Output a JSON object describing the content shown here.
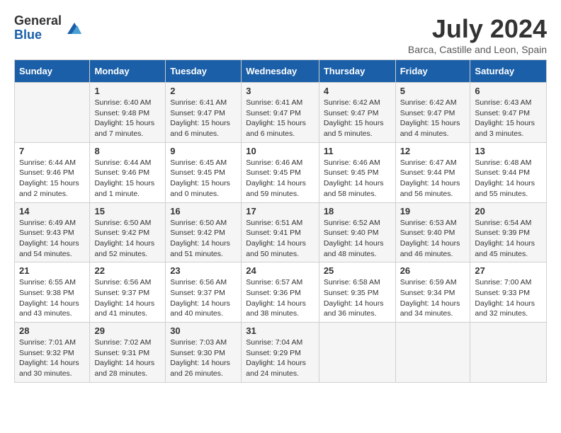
{
  "header": {
    "logo_general": "General",
    "logo_blue": "Blue",
    "month_title": "July 2024",
    "location": "Barca, Castille and Leon, Spain"
  },
  "days_of_week": [
    "Sunday",
    "Monday",
    "Tuesday",
    "Wednesday",
    "Thursday",
    "Friday",
    "Saturday"
  ],
  "weeks": [
    [
      {
        "day": "",
        "text": ""
      },
      {
        "day": "1",
        "text": "Sunrise: 6:40 AM\nSunset: 9:48 PM\nDaylight: 15 hours\nand 7 minutes."
      },
      {
        "day": "2",
        "text": "Sunrise: 6:41 AM\nSunset: 9:47 PM\nDaylight: 15 hours\nand 6 minutes."
      },
      {
        "day": "3",
        "text": "Sunrise: 6:41 AM\nSunset: 9:47 PM\nDaylight: 15 hours\nand 6 minutes."
      },
      {
        "day": "4",
        "text": "Sunrise: 6:42 AM\nSunset: 9:47 PM\nDaylight: 15 hours\nand 5 minutes."
      },
      {
        "day": "5",
        "text": "Sunrise: 6:42 AM\nSunset: 9:47 PM\nDaylight: 15 hours\nand 4 minutes."
      },
      {
        "day": "6",
        "text": "Sunrise: 6:43 AM\nSunset: 9:47 PM\nDaylight: 15 hours\nand 3 minutes."
      }
    ],
    [
      {
        "day": "7",
        "text": "Sunrise: 6:44 AM\nSunset: 9:46 PM\nDaylight: 15 hours\nand 2 minutes."
      },
      {
        "day": "8",
        "text": "Sunrise: 6:44 AM\nSunset: 9:46 PM\nDaylight: 15 hours\nand 1 minute."
      },
      {
        "day": "9",
        "text": "Sunrise: 6:45 AM\nSunset: 9:45 PM\nDaylight: 15 hours\nand 0 minutes."
      },
      {
        "day": "10",
        "text": "Sunrise: 6:46 AM\nSunset: 9:45 PM\nDaylight: 14 hours\nand 59 minutes."
      },
      {
        "day": "11",
        "text": "Sunrise: 6:46 AM\nSunset: 9:45 PM\nDaylight: 14 hours\nand 58 minutes."
      },
      {
        "day": "12",
        "text": "Sunrise: 6:47 AM\nSunset: 9:44 PM\nDaylight: 14 hours\nand 56 minutes."
      },
      {
        "day": "13",
        "text": "Sunrise: 6:48 AM\nSunset: 9:44 PM\nDaylight: 14 hours\nand 55 minutes."
      }
    ],
    [
      {
        "day": "14",
        "text": "Sunrise: 6:49 AM\nSunset: 9:43 PM\nDaylight: 14 hours\nand 54 minutes."
      },
      {
        "day": "15",
        "text": "Sunrise: 6:50 AM\nSunset: 9:42 PM\nDaylight: 14 hours\nand 52 minutes."
      },
      {
        "day": "16",
        "text": "Sunrise: 6:50 AM\nSunset: 9:42 PM\nDaylight: 14 hours\nand 51 minutes."
      },
      {
        "day": "17",
        "text": "Sunrise: 6:51 AM\nSunset: 9:41 PM\nDaylight: 14 hours\nand 50 minutes."
      },
      {
        "day": "18",
        "text": "Sunrise: 6:52 AM\nSunset: 9:40 PM\nDaylight: 14 hours\nand 48 minutes."
      },
      {
        "day": "19",
        "text": "Sunrise: 6:53 AM\nSunset: 9:40 PM\nDaylight: 14 hours\nand 46 minutes."
      },
      {
        "day": "20",
        "text": "Sunrise: 6:54 AM\nSunset: 9:39 PM\nDaylight: 14 hours\nand 45 minutes."
      }
    ],
    [
      {
        "day": "21",
        "text": "Sunrise: 6:55 AM\nSunset: 9:38 PM\nDaylight: 14 hours\nand 43 minutes."
      },
      {
        "day": "22",
        "text": "Sunrise: 6:56 AM\nSunset: 9:37 PM\nDaylight: 14 hours\nand 41 minutes."
      },
      {
        "day": "23",
        "text": "Sunrise: 6:56 AM\nSunset: 9:37 PM\nDaylight: 14 hours\nand 40 minutes."
      },
      {
        "day": "24",
        "text": "Sunrise: 6:57 AM\nSunset: 9:36 PM\nDaylight: 14 hours\nand 38 minutes."
      },
      {
        "day": "25",
        "text": "Sunrise: 6:58 AM\nSunset: 9:35 PM\nDaylight: 14 hours\nand 36 minutes."
      },
      {
        "day": "26",
        "text": "Sunrise: 6:59 AM\nSunset: 9:34 PM\nDaylight: 14 hours\nand 34 minutes."
      },
      {
        "day": "27",
        "text": "Sunrise: 7:00 AM\nSunset: 9:33 PM\nDaylight: 14 hours\nand 32 minutes."
      }
    ],
    [
      {
        "day": "28",
        "text": "Sunrise: 7:01 AM\nSunset: 9:32 PM\nDaylight: 14 hours\nand 30 minutes."
      },
      {
        "day": "29",
        "text": "Sunrise: 7:02 AM\nSunset: 9:31 PM\nDaylight: 14 hours\nand 28 minutes."
      },
      {
        "day": "30",
        "text": "Sunrise: 7:03 AM\nSunset: 9:30 PM\nDaylight: 14 hours\nand 26 minutes."
      },
      {
        "day": "31",
        "text": "Sunrise: 7:04 AM\nSunset: 9:29 PM\nDaylight: 14 hours\nand 24 minutes."
      },
      {
        "day": "",
        "text": ""
      },
      {
        "day": "",
        "text": ""
      },
      {
        "day": "",
        "text": ""
      }
    ]
  ]
}
